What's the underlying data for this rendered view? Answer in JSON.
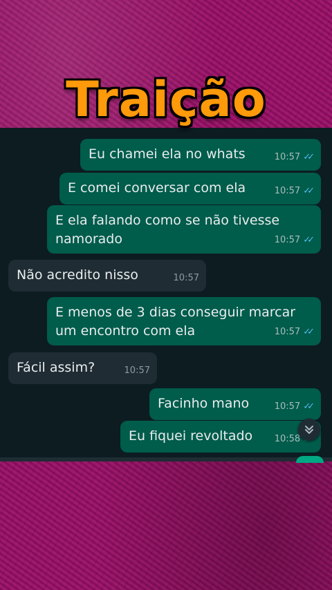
{
  "title": "Traição",
  "messages": [
    {
      "text": "Eu chamei ela no whats",
      "time": "10:57",
      "direction": "out"
    },
    {
      "text": "E comei conversar com ela",
      "time": "10:57",
      "direction": "out"
    },
    {
      "text": "E ela falando como se não tivesse namorado",
      "time": "10:57",
      "direction": "out"
    },
    {
      "text": "Não acredito nisso",
      "time": "10:57",
      "direction": "in"
    },
    {
      "text": "E menos de 3 dias conseguir marcar um encontro com ela",
      "time": "10:57",
      "direction": "out"
    },
    {
      "text": "Fácil assim?",
      "time": "10:57",
      "direction": "in"
    },
    {
      "text": "Facinho mano",
      "time": "10:57",
      "direction": "out"
    },
    {
      "text": "Eu fiquei revoltado",
      "time": "10:58",
      "direction": "out"
    }
  ],
  "colors": {
    "background": "#9b1068",
    "title": "#ff9a0a",
    "chat_bg": "#0c1c21",
    "outgoing_bubble": "#005c4b",
    "incoming_bubble": "#1f2c33",
    "read_ticks": "#53bdeb"
  },
  "icons": {
    "read_receipt": "double-check-icon",
    "scroll_down": "double-chevron-down-icon"
  }
}
